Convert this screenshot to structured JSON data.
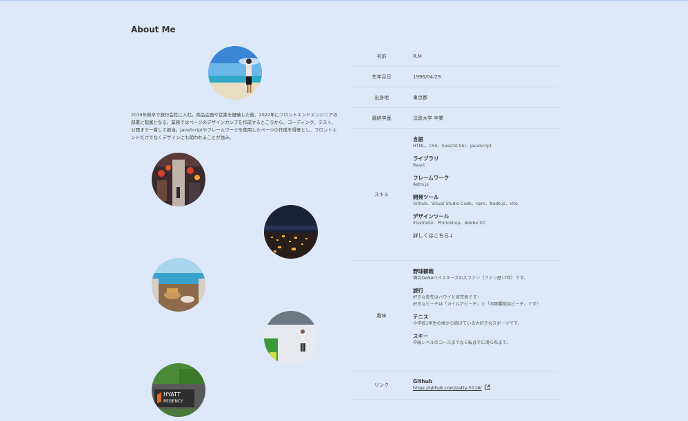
{
  "page": {
    "title": "About Me",
    "bio": "2019年新卒で旅行会社に入社。商品企画や営業を経験した後、2022年にフロントエンドエンジニアの部署に配属となる。業務ではページのデザインカンプを作成するところから、コーディング、テスト、公開まで一貫して担当。JavaScriptやフレームワークを使用したページの作成を得意とし、フロントエンドだけでなくデザインにも関われることが強み。"
  },
  "profile": {
    "name_label": "名前",
    "name_value": "R.M",
    "birth_label": "生年月日",
    "birth_value": "1996/04/29",
    "origin_label": "出身地",
    "origin_value": "東京都",
    "edu_label": "最終学歴",
    "edu_value": "法政大学 卒業"
  },
  "skills": {
    "label": "スキル",
    "groups": [
      {
        "title": "言語",
        "text": "HTML、CSS、Sass(SCSS)、JavaScript"
      },
      {
        "title": "ライブラリ",
        "text": "React"
      },
      {
        "title": "フレームワーク",
        "text": "Astro.js"
      },
      {
        "title": "開発ツール",
        "text": "Github、Visual Studio Code、npm、Node.js、vite"
      },
      {
        "title": "デザインツール",
        "text": "illustrator、Photoshop、Adobe XD"
      }
    ],
    "more": "詳しくはこちら↓"
  },
  "hobbies": {
    "label": "趣味",
    "items": [
      {
        "title": "野球観戦",
        "text": "横浜DeNAベイスターズの大ファン（ファン歴17年）です。"
      },
      {
        "title": "旅行",
        "text": "好きな旅先はハワイと宮古島です！",
        "text2": "好きなビーチは「カイルアビーチ」と「与那覇前浜ビーチ」です！"
      },
      {
        "title": "テニス",
        "text": "小学校1年生の頃から続けている大好きなスポーツです。"
      },
      {
        "title": "スキー",
        "text": "中級レベルのコースまでなら転ばずに滑られます。"
      }
    ]
  },
  "links": {
    "label": "リンク",
    "title": "Github",
    "url": "https://github.com/zatty-5118/"
  },
  "photos": [
    "avatar-beach",
    "street-night",
    "city-night",
    "cafe-ocean",
    "tennis-court",
    "hyatt-regency-sign"
  ],
  "photo_text": {
    "hyatt": "HYATT",
    "regency": "REGENCY"
  }
}
